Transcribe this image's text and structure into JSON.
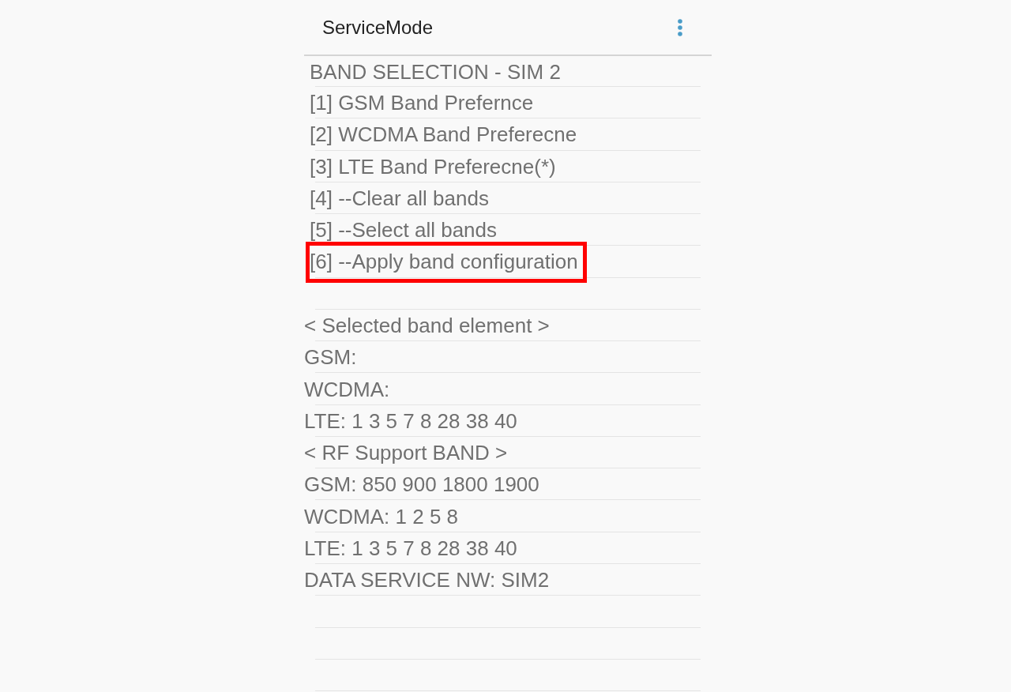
{
  "app_bar": {
    "title": "ServiceMode"
  },
  "menu": {
    "title": "BAND SELECTION - SIM 2",
    "items": [
      {
        "label": "[1] GSM Band Prefernce",
        "highlighted": false
      },
      {
        "label": "[2] WCDMA Band Preferecne",
        "highlighted": false
      },
      {
        "label": "[3] LTE Band Preferecne(*)",
        "highlighted": false
      },
      {
        "label": "[4] --Clear all bands",
        "highlighted": false
      },
      {
        "label": "[5] --Select all bands",
        "highlighted": false
      },
      {
        "label": "[6] --Apply band configuration",
        "highlighted": true
      }
    ]
  },
  "info_lines": [
    "< Selected band element >",
    "GSM:",
    "WCDMA:",
    "LTE: 1 3 5 7 8 28 38 40",
    "< RF Support BAND >",
    "GSM: 850 900 1800 1900",
    "WCDMA: 1 2 5 8",
    "LTE: 1 3 5 7 8 28 38 40",
    "DATA SERVICE NW: SIM2"
  ]
}
